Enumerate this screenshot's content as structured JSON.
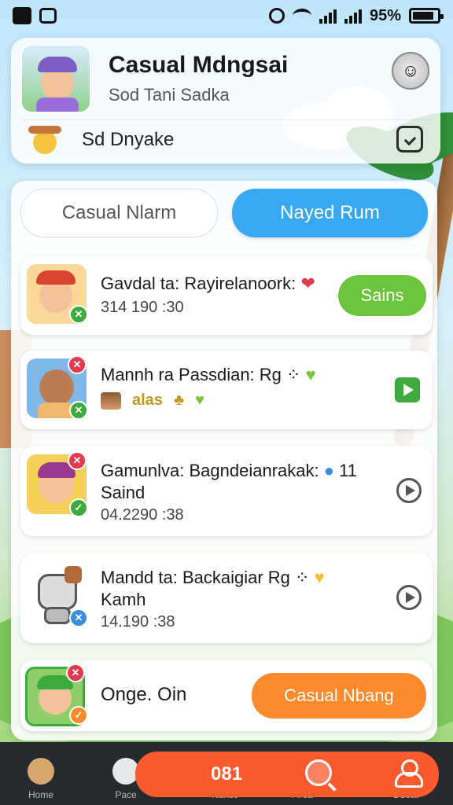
{
  "status_bar": {
    "battery": "95%"
  },
  "header": {
    "title": "Casual Mdngsai",
    "subtitle": "Sod Tani Sadka",
    "user_name": "Sd Dnyake"
  },
  "tabs": [
    {
      "label": "Casual Nlarm",
      "active": false
    },
    {
      "label": "Nayed Rum",
      "active": true
    }
  ],
  "rows": [
    {
      "title": "Gavdal ta: Rayirelanoork",
      "time": "314 190 :30",
      "action_label": "Sains",
      "action_color": "#6cc43c",
      "badge_color": "#3daa3d",
      "heart": "❤"
    },
    {
      "title": "Mannh ra Passdian: Rg",
      "time": "",
      "action_label": "",
      "badge_color": "#3daa3d",
      "top_badge_color": "#e53950",
      "heart": "♥",
      "strip_text": "alas"
    },
    {
      "title": "Gamunlva: Bagndeianrakak:",
      "extra": "11",
      "line2": "Saind",
      "time": "04.2290 :38",
      "badge_color": "#3daa3d",
      "top_badge_color": "#e53950"
    },
    {
      "title": "Mandd ta: Backaigiar Rg",
      "line2": "Kamh",
      "time": "14.190 :38",
      "badge_color": "#3a8ee0",
      "heart": "♥"
    },
    {
      "title": "Onge. Oin",
      "action_label": "Casual Nbang",
      "action_color": "#fb8a2c",
      "badge_color": "#fb8a2c",
      "top_badge_color": "#e53950"
    }
  ],
  "bottom_nav": {
    "items": [
      {
        "label": "Home"
      },
      {
        "label": "Pace"
      },
      {
        "label": "Nanss"
      },
      {
        "label": "Flrea"
      },
      {
        "label": "Duoat"
      }
    ],
    "center_count": "081"
  }
}
